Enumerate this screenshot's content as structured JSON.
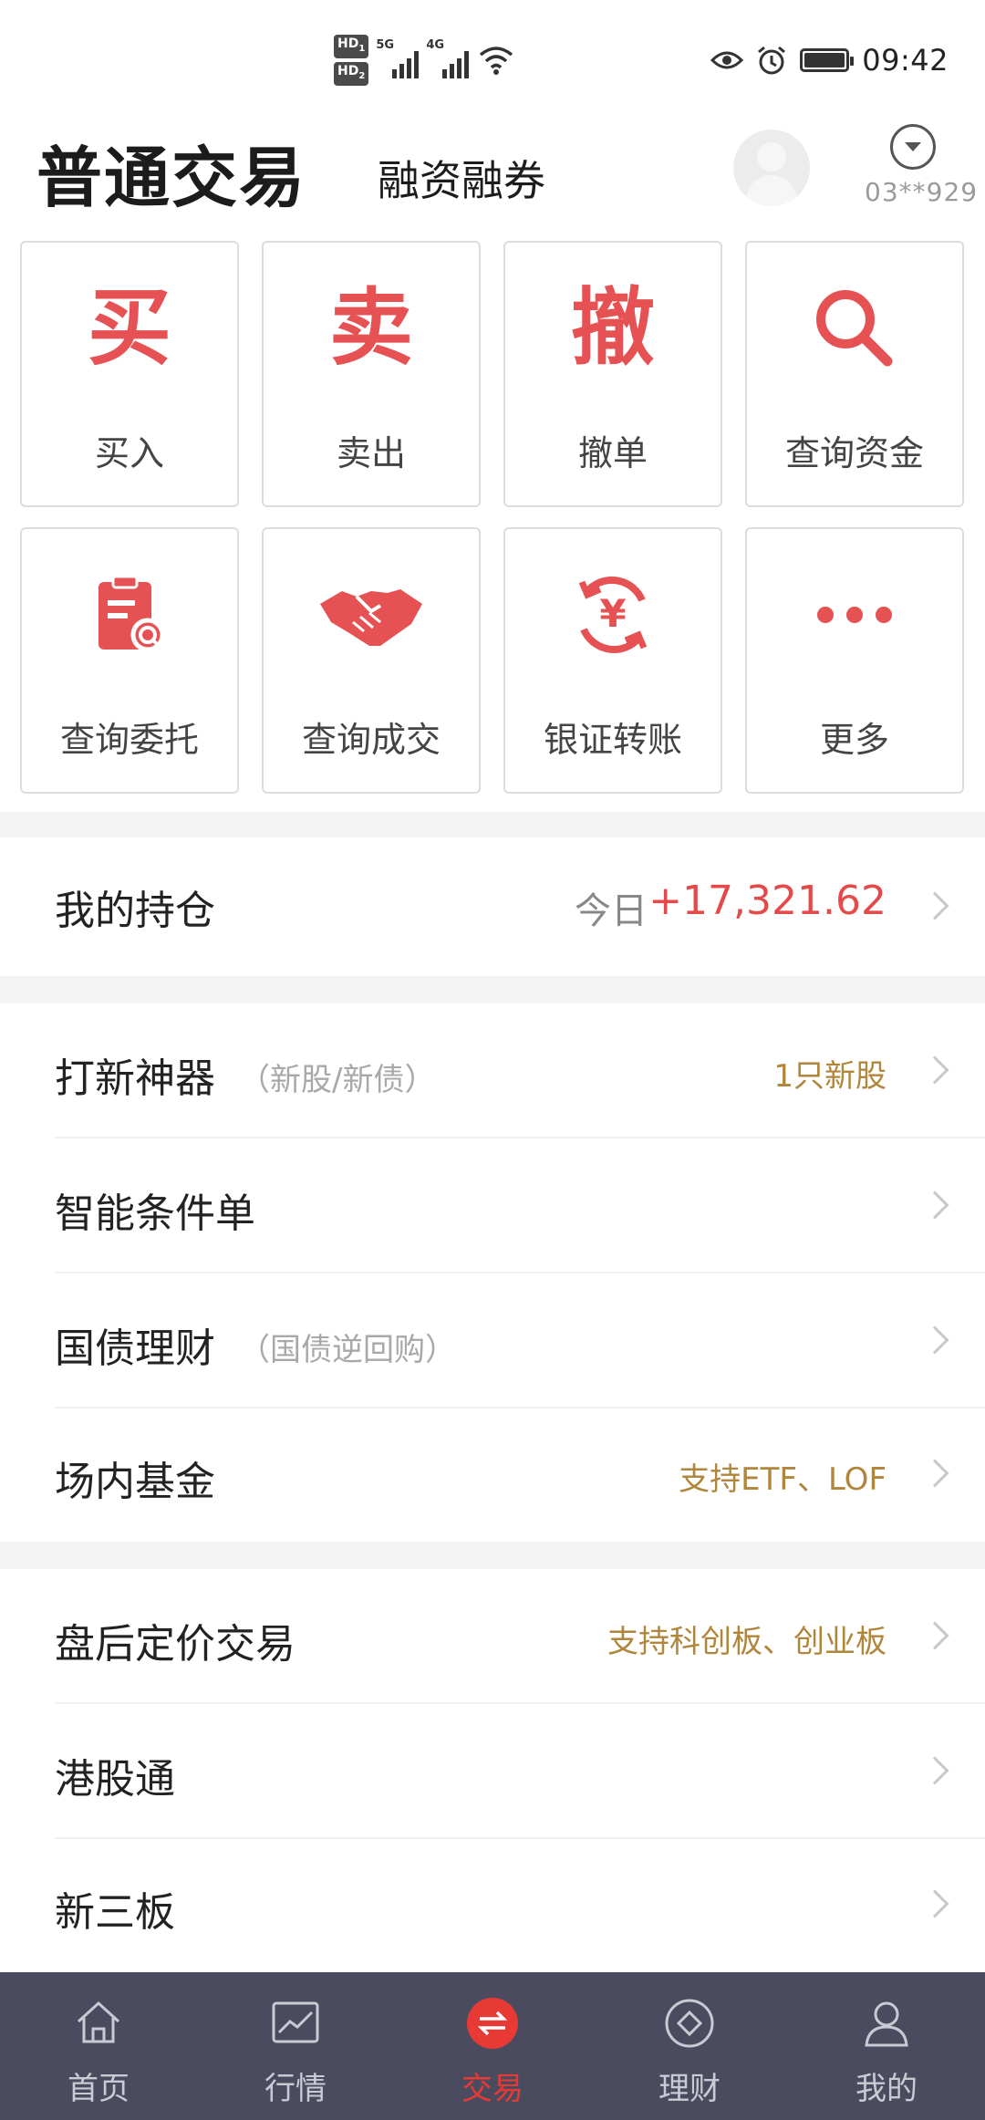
{
  "status_bar": {
    "hd1": "HD",
    "hd1_sub": "1",
    "hd2": "HD",
    "hd2_sub": "2",
    "net1": "5G",
    "net2": "4G",
    "time": "09:42",
    "icons": [
      "eye-icon",
      "alarm-icon",
      "battery-icon",
      "wifi-icon",
      "signal-icon"
    ]
  },
  "header": {
    "title": "普通交易",
    "subtitle": "融资融券",
    "account_id": "03**929"
  },
  "actions": [
    {
      "label": "买入",
      "glyph": "买",
      "icon": "buy-icon"
    },
    {
      "label": "卖出",
      "glyph": "卖",
      "icon": "sell-icon"
    },
    {
      "label": "撤单",
      "glyph": "撤",
      "icon": "cancel-order-icon"
    },
    {
      "label": "查询资金",
      "icon": "search-icon"
    },
    {
      "label": "查询委托",
      "icon": "clipboard-search-icon"
    },
    {
      "label": "查询成交",
      "icon": "handshake-icon"
    },
    {
      "label": "银证转账",
      "glyph": "¥",
      "icon": "yen-transfer-icon"
    },
    {
      "label": "更多",
      "icon": "more-dots-icon"
    }
  ],
  "positions": {
    "title": "我的持仓",
    "today_label": "今日",
    "today_value": "+17,321.62"
  },
  "list_group_1": [
    {
      "title": "打新神器",
      "hint": "（新股/新债）",
      "right": "1只新股"
    },
    {
      "title": "智能条件单",
      "hint": "",
      "right": ""
    },
    {
      "title": "国债理财",
      "hint": "（国债逆回购）",
      "right": ""
    },
    {
      "title": "场内基金",
      "hint": "",
      "right": "支持ETF、LOF"
    }
  ],
  "list_group_2": [
    {
      "title": "盘后定价交易",
      "hint": "",
      "right": "支持科创板、创业板"
    },
    {
      "title": "港股通",
      "hint": "",
      "right": ""
    },
    {
      "title": "新三板",
      "hint": "",
      "right": ""
    }
  ],
  "bottom_nav": [
    {
      "label": "首页",
      "icon": "home-icon"
    },
    {
      "label": "行情",
      "icon": "chart-icon"
    },
    {
      "label": "交易",
      "icon": "trade-exchange-icon",
      "active": true
    },
    {
      "label": "理财",
      "icon": "wealth-diamond-icon"
    },
    {
      "label": "我的",
      "icon": "user-icon"
    }
  ],
  "colors": {
    "accent_red": "#e65253",
    "gain_red": "#e54a4b",
    "gold": "#b0853c",
    "nav_bg": "#4a4b5e"
  }
}
